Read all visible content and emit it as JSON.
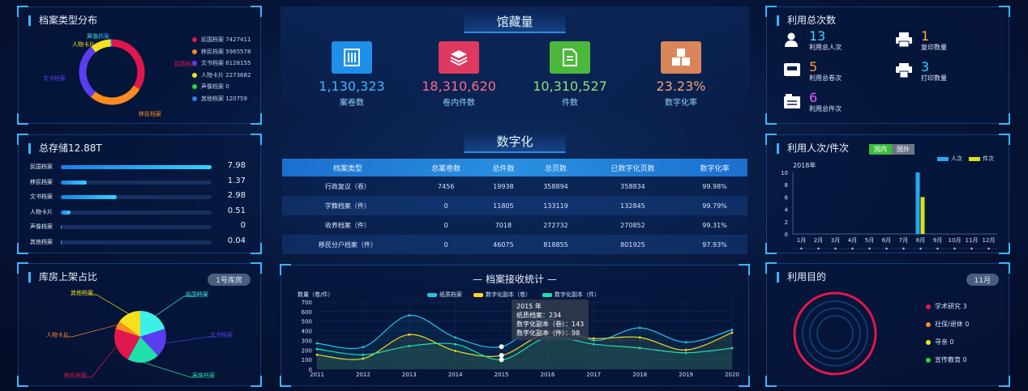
{
  "archive_dist": {
    "title": "档案类型分布",
    "legend": [
      {
        "label": "民国档案 7427411",
        "color": "#e0174d"
      },
      {
        "label": "移民档案 5965578",
        "color": "#ff8a1f"
      },
      {
        "label": "文书档案 6128155",
        "color": "#5a3df0"
      },
      {
        "label": "人物卡片 2273682",
        "color": "#f6e11c"
      },
      {
        "label": "声像档案 0",
        "color": "#22dd33"
      },
      {
        "label": "其他档案 120759",
        "color": "#2f7ff7"
      }
    ],
    "slices": [
      {
        "label": "民国档案",
        "value": 7427411,
        "color": "#e0174d"
      },
      {
        "label": "移民档案",
        "value": 5965578,
        "color": "#ff8a1f"
      },
      {
        "label": "文书档案",
        "value": 6128155,
        "color": "#5a3df0"
      },
      {
        "label": "人物卡片",
        "value": 2273682,
        "color": "#f6e11c"
      },
      {
        "label": "声像档案",
        "value": 0,
        "color": "#22dd33"
      },
      {
        "label": "其他档案",
        "value": 120759,
        "color": "#2f7ff7"
      }
    ]
  },
  "storage": {
    "title": "总存储12.88T",
    "rows": [
      {
        "label": "民国档案",
        "value": "7.98",
        "ratio": 1.0
      },
      {
        "label": "移民档案",
        "value": "1.37",
        "ratio": 0.17
      },
      {
        "label": "文书档案",
        "value": "2.98",
        "ratio": 0.37
      },
      {
        "label": "人物卡片",
        "value": "0.51",
        "ratio": 0.064
      },
      {
        "label": "声像档案",
        "value": "0",
        "ratio": 0
      },
      {
        "label": "其他档案",
        "value": "0.04",
        "ratio": 0.005
      }
    ]
  },
  "shelf": {
    "title": "库房上架占比",
    "badge": "1号库房",
    "slices": [
      {
        "label": "民国档案",
        "color": "#3cf0e8",
        "pct": 20
      },
      {
        "label": "文书档案",
        "color": "#5a3df0",
        "pct": 18
      },
      {
        "label": "声像档案",
        "color": "#1fe0a8",
        "pct": 20
      },
      {
        "label": "移民档案",
        "color": "#e0174d",
        "pct": 22
      },
      {
        "label": "人物卡片",
        "color": "#ff8a1f",
        "pct": 5
      },
      {
        "label": "其他档案",
        "color": "#f6e11c",
        "pct": 15
      }
    ]
  },
  "collection": {
    "title": "馆藏量",
    "stats": [
      {
        "num": "1,130,323",
        "label": "案卷数",
        "color": "#40b6ff",
        "bg": "#1e8fe8",
        "icon": "folder-icon"
      },
      {
        "num": "18,310,620",
        "label": "卷内件数",
        "color": "#ff6a8a",
        "bg": "#e0395f",
        "icon": "stack-icon"
      },
      {
        "num": "10,310,527",
        "label": "件数",
        "color": "#8fe07a",
        "bg": "#4cb83c",
        "icon": "document-icon"
      },
      {
        "num": "23.23%",
        "label": "数字化率",
        "color": "#f2a67a",
        "bg": "#d9855a",
        "icon": "cubes-icon"
      }
    ]
  },
  "digitization": {
    "title": "数字化",
    "headers": [
      "档案类型",
      "总案卷数",
      "总件数",
      "总页数",
      "已数字化页数",
      "数字化率"
    ],
    "rows": [
      [
        "行政复议（卷）",
        "7456",
        "19938",
        "358894",
        "358834",
        "99.98%"
      ],
      [
        "学籍档案（件）",
        "0",
        "11805",
        "133119",
        "132845",
        "99.79%"
      ],
      [
        "收养档案（件）",
        "0",
        "7018",
        "272732",
        "270852",
        "99.31%"
      ],
      [
        "移民分户档案（件）",
        "0",
        "46075",
        "818855",
        "801925",
        "97.93%"
      ]
    ]
  },
  "receive": {
    "title": "档案接收统计",
    "ylabel": "数量（卷/件）",
    "legend": [
      {
        "label": "纸质档案",
        "color": "#27c3e8"
      },
      {
        "label": "数字化副本（卷）",
        "color": "#f6d81c"
      },
      {
        "label": "数字化副本（件）",
        "color": "#1fe0b0"
      }
    ],
    "tooltip": {
      "year": "2015 年",
      "line1": "纸质档案：234",
      "line2": "数字化副本（卷）：143",
      "line3": "数字化副本（件）：98"
    }
  },
  "chart_data": {
    "type": "line",
    "x": [
      "2011",
      "2012",
      "2013",
      "2014",
      "2015",
      "2016",
      "2017",
      "2018",
      "2019",
      "2020"
    ],
    "ylim": [
      0,
      700
    ],
    "yticks": [
      "0",
      "100",
      "200",
      "300",
      "400",
      "500",
      "600",
      "700"
    ],
    "ylabel": "数量（卷/件）",
    "title": "档案接收统计",
    "series": [
      {
        "name": "纸质档案",
        "color": "#27c3e8",
        "values": [
          270,
          230,
          560,
          330,
          234,
          520,
          300,
          430,
          280,
          410
        ]
      },
      {
        "name": "数字化副本（卷）",
        "color": "#f6d81c",
        "values": [
          150,
          110,
          360,
          190,
          143,
          380,
          320,
          330,
          200,
          380
        ]
      },
      {
        "name": "数字化副本（件）",
        "color": "#1fe0b0",
        "values": [
          210,
          150,
          240,
          260,
          98,
          330,
          260,
          220,
          170,
          220
        ]
      }
    ]
  },
  "usage_total": {
    "title": "利用总次数",
    "items": [
      {
        "num": "13",
        "label": "利用总人次",
        "color": "#3ad3ff",
        "icon": "person-icon"
      },
      {
        "num": "1",
        "label": "复印数量",
        "color": "#ffb51c",
        "icon": "printer-icon"
      },
      {
        "num": "5",
        "label": "利用总卷次",
        "color": "#ff9a2a",
        "icon": "inbox-icon"
      },
      {
        "num": "3",
        "label": "打印数量",
        "color": "#3ad3ff",
        "icon": "print-icon"
      },
      {
        "num": "6",
        "label": "利用总件次",
        "color": "#e85cff",
        "icon": "files-icon"
      }
    ]
  },
  "usage_chart": {
    "title": "利用人次/件次",
    "tabs": [
      "国内",
      "国外"
    ],
    "year": "2018年",
    "legend": [
      {
        "label": "人次",
        "color": "#27a8f0"
      },
      {
        "label": "件次",
        "color": "#d8e31c"
      }
    ],
    "months": [
      "1月",
      "2月",
      "3月",
      "4月",
      "5月",
      "6月",
      "7月",
      "8月",
      "9月",
      "10月",
      "11月",
      "12月"
    ],
    "yticks": [
      "0",
      "2",
      "4",
      "6",
      "8",
      "10"
    ],
    "persons": [
      0,
      0,
      0,
      0,
      0,
      0,
      0,
      10,
      0,
      0,
      0,
      0
    ],
    "items": [
      0,
      0,
      0,
      0,
      0,
      0,
      0,
      6,
      0,
      0,
      0,
      0
    ]
  },
  "usage_purpose": {
    "title": "利用目的",
    "badge": "11月",
    "legend": [
      {
        "label": "学术研究  3",
        "color": "#e0174d"
      },
      {
        "label": "社保/退休  0",
        "color": "#ff8a1f"
      },
      {
        "label": "寻亲  0",
        "color": "#f6e11c"
      },
      {
        "label": "宣传教育  0",
        "color": "#22dd33"
      }
    ]
  }
}
